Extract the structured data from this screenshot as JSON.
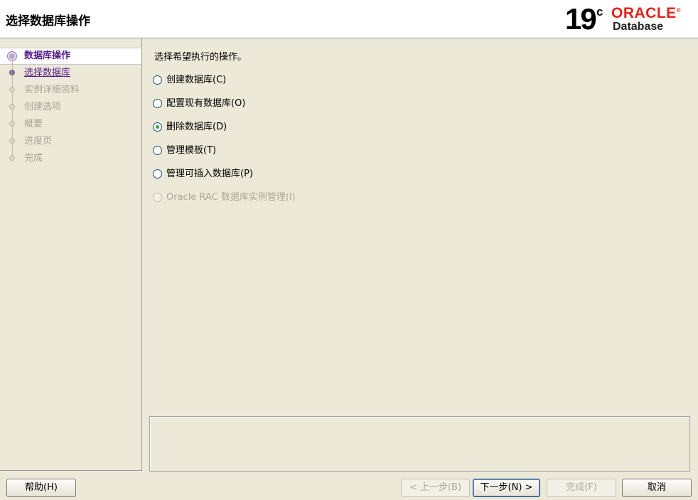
{
  "header": {
    "title": "选择数据库操作",
    "logo": {
      "version": "19",
      "version_suffix": "c",
      "brand": "ORACLE",
      "registered": "®",
      "product": "Database"
    }
  },
  "steps": [
    {
      "label": "数据库操作",
      "state": "current"
    },
    {
      "label": "选择数据库",
      "state": "active"
    },
    {
      "label": "实例详细资料",
      "state": "disabled"
    },
    {
      "label": "创建选项",
      "state": "disabled"
    },
    {
      "label": "概要",
      "state": "disabled"
    },
    {
      "label": "进度页",
      "state": "disabled"
    },
    {
      "label": "完成",
      "state": "disabled"
    }
  ],
  "main": {
    "instruction": "选择希望执行的操作。",
    "options": [
      {
        "label": "创建数据库(C)",
        "selected": false,
        "enabled": true
      },
      {
        "label": "配置现有数据库(O)",
        "selected": false,
        "enabled": true
      },
      {
        "label": "删除数据库(D)",
        "selected": true,
        "enabled": true
      },
      {
        "label": "管理模板(T)",
        "selected": false,
        "enabled": true
      },
      {
        "label": "管理可插入数据库(P)",
        "selected": false,
        "enabled": true
      },
      {
        "label": "Oracle RAC 数据库实例管理(I)",
        "selected": false,
        "enabled": false
      }
    ]
  },
  "buttons": {
    "help": "帮助(H)",
    "back": "< 上一步(B)",
    "next": "下一步(N) >",
    "finish": "完成(F)",
    "cancel": "取消"
  },
  "colors": {
    "brand_red": "#e2231a",
    "step_purple": "#551a8b",
    "window_bg": "#ece9d8"
  }
}
